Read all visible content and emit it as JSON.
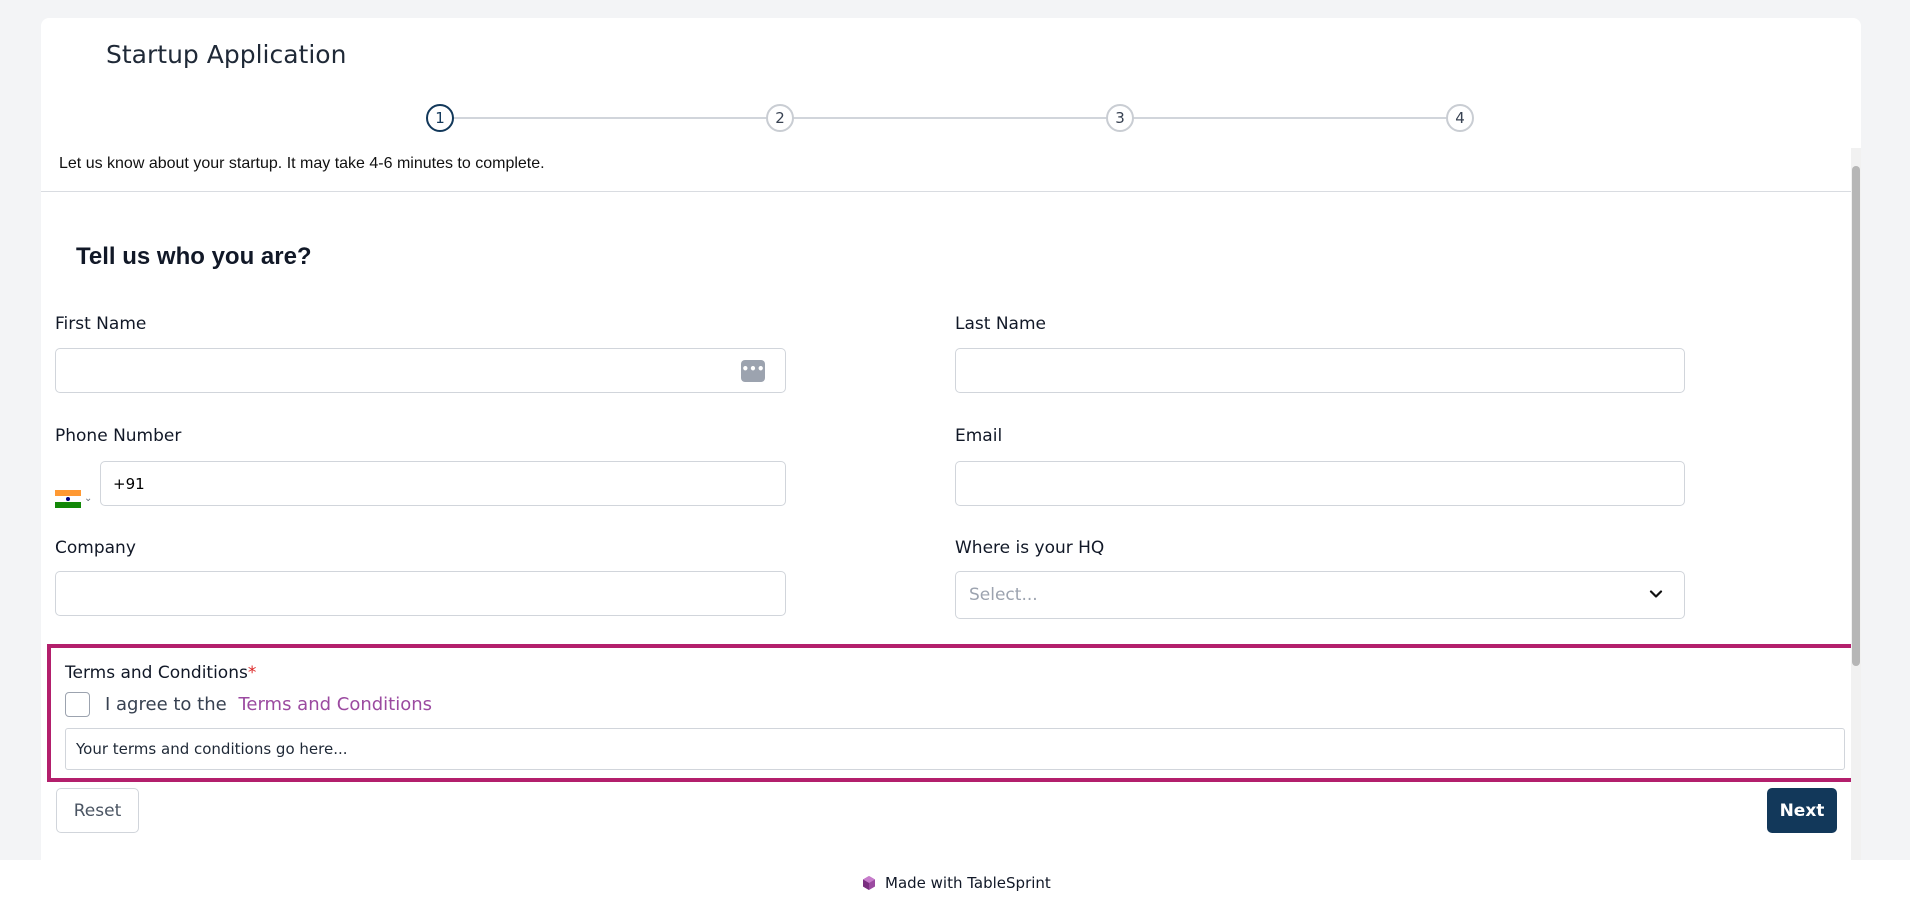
{
  "app": {
    "title": "Startup Application"
  },
  "stepper": {
    "steps": [
      "1",
      "2",
      "3",
      "4"
    ],
    "active": 1
  },
  "intro": "Let us know about your startup. It may take 4-6 minutes to complete.",
  "section": {
    "title": "Tell us who you are?"
  },
  "fields": {
    "first_name": {
      "label": "First Name",
      "value": ""
    },
    "last_name": {
      "label": "Last Name",
      "value": ""
    },
    "phone": {
      "label": "Phone Number",
      "value": "+91",
      "country": "India"
    },
    "email": {
      "label": "Email",
      "value": ""
    },
    "company": {
      "label": "Company",
      "value": ""
    },
    "hq": {
      "label": "Where is your HQ",
      "placeholder": "Select..."
    }
  },
  "terms": {
    "label": "Terms and Conditions",
    "required_mark": "*",
    "agree_text": "I agree to the",
    "link_text": "Terms and Conditions",
    "body": "Your terms and conditions go here...",
    "checked": false
  },
  "buttons": {
    "reset": "Reset",
    "next": "Next"
  },
  "footer": {
    "text": "Made with TableSprint"
  },
  "colors": {
    "primary": "#12385a",
    "highlight": "#b31f6c",
    "link": "#9b4aa0",
    "required": "#dc2626"
  },
  "icons": {
    "password_manager": "password-manager-icon",
    "flag": "india-flag-icon",
    "dropdown": "chevron-down-icon",
    "logo": "tablesprint-logo-icon"
  }
}
